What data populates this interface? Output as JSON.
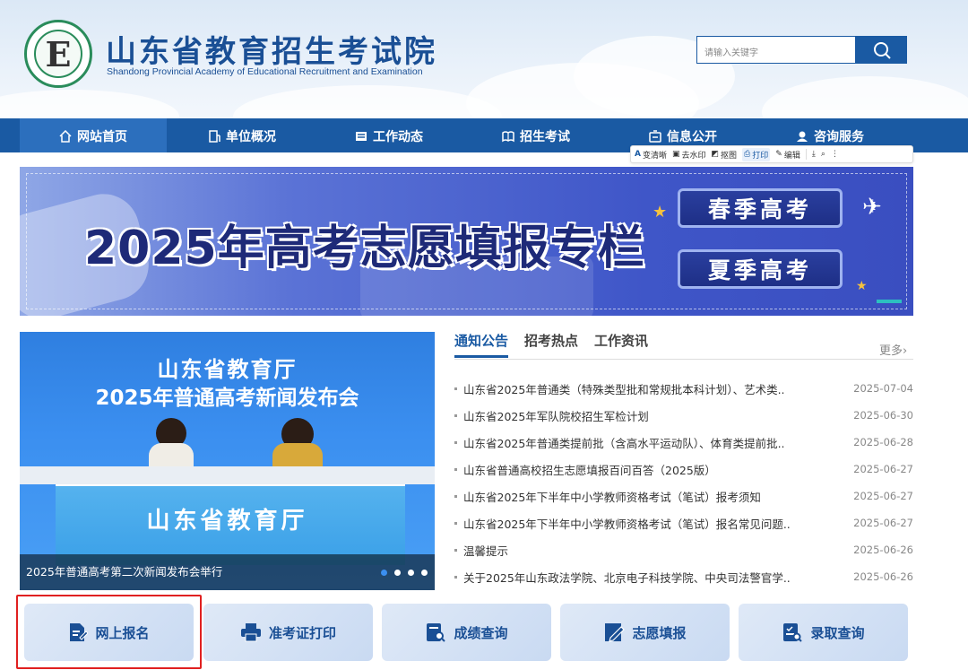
{
  "header": {
    "logo_letter": "E",
    "title": "山东省教育招生考试院",
    "subtitle": "Shandong Provincial Academy of Educational Recruitment and Examination",
    "search_placeholder": "请输入关键字"
  },
  "nav": [
    {
      "label": "网站首页",
      "icon": "home-icon"
    },
    {
      "label": "单位概况",
      "icon": "building-icon"
    },
    {
      "label": "工作动态",
      "icon": "news-icon"
    },
    {
      "label": "招生考试",
      "icon": "book-icon"
    },
    {
      "label": "信息公开",
      "icon": "info-icon"
    },
    {
      "label": "咨询服务",
      "icon": "headset-icon"
    }
  ],
  "toolbar": [
    {
      "label": "变清晰",
      "icon": "enhance-icon"
    },
    {
      "label": "去水印",
      "icon": "watermark-icon"
    },
    {
      "label": "抠图",
      "icon": "cutout-icon"
    },
    {
      "label": "打印",
      "icon": "print-icon"
    },
    {
      "label": "编辑",
      "icon": "edit-icon"
    }
  ],
  "banner": {
    "title": "2025年高考志愿填报专栏",
    "buttons": [
      "春季高考",
      "夏季高考"
    ]
  },
  "slider": {
    "line1": "山东省教育厅",
    "line2": "2025年普通高考新闻发布会",
    "backdrop": "山东省教育厅",
    "caption": "2025年普通高考第二次新闻发布会举行",
    "slides": 4,
    "active_slide": 1
  },
  "news": {
    "tabs": [
      "通知公告",
      "招考热点",
      "工作资讯"
    ],
    "more": "更多",
    "items": [
      {
        "title": "山东省2025年普通类（特殊类型批和常规批本科计划）、艺术类..",
        "date": "2025-07-04"
      },
      {
        "title": "山东省2025年军队院校招生军检计划",
        "date": "2025-06-30"
      },
      {
        "title": "山东省2025年普通类提前批（含高水平运动队）、体育类提前批..",
        "date": "2025-06-28"
      },
      {
        "title": "山东省普通高校招生志愿填报百问百答（2025版）",
        "date": "2025-06-27"
      },
      {
        "title": "山东省2025年下半年中小学教师资格考试（笔试）报考须知",
        "date": "2025-06-27"
      },
      {
        "title": "山东省2025年下半年中小学教师资格考试（笔试）报名常见问题..",
        "date": "2025-06-27"
      },
      {
        "title": "温馨提示",
        "date": "2025-06-26"
      },
      {
        "title": "关于2025年山东政法学院、北京电子科技学院、中央司法警官学..",
        "date": "2025-06-26"
      }
    ]
  },
  "quick": [
    {
      "label": "网上报名",
      "icon": "register-icon"
    },
    {
      "label": "准考证打印",
      "icon": "printer-icon"
    },
    {
      "label": "成绩查询",
      "icon": "score-search-icon"
    },
    {
      "label": "志愿填报",
      "icon": "volunteer-edit-icon"
    },
    {
      "label": "录取查询",
      "icon": "admission-search-icon"
    }
  ],
  "colors": {
    "primary": "#1a5aa3",
    "highlight": "#e02020"
  }
}
